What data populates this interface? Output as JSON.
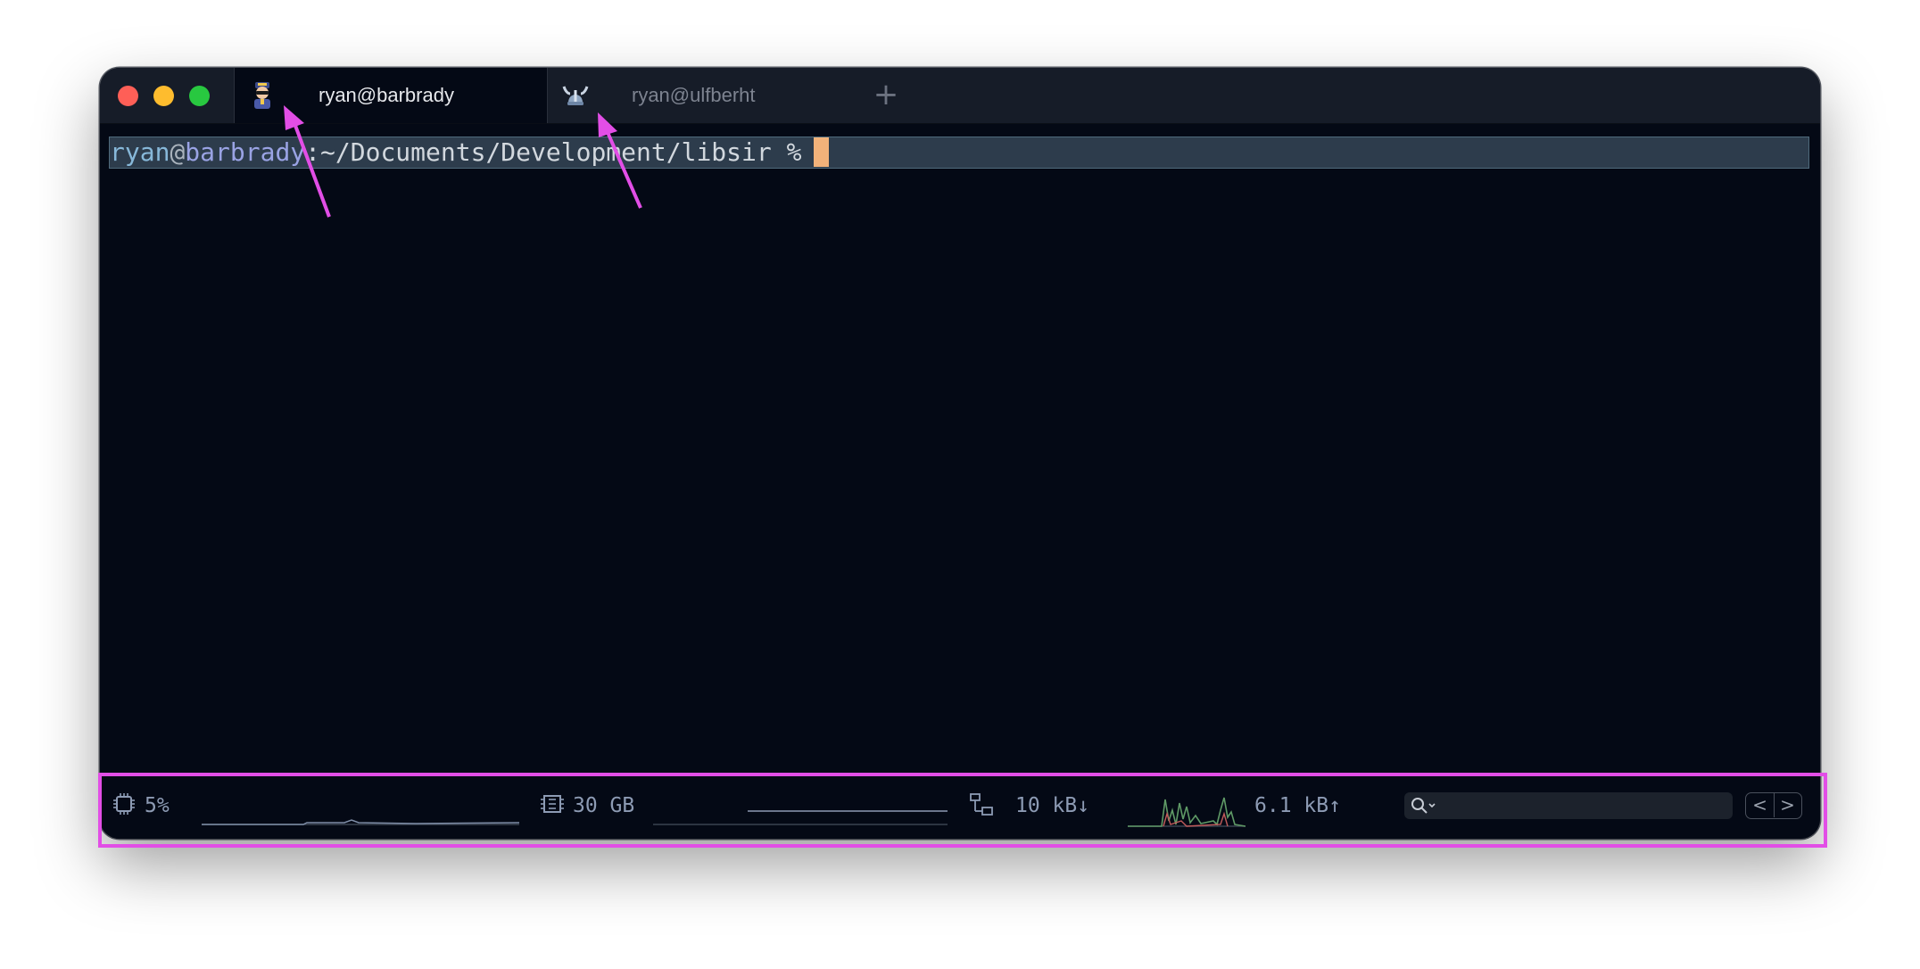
{
  "window": {
    "tabs": [
      {
        "label": "ryan@barbrady",
        "icon": "police-officer-icon",
        "active": true
      },
      {
        "label": "ryan@ulfberht",
        "icon": "viking-helmet-icon",
        "active": false
      }
    ],
    "new_tab_label": "+"
  },
  "terminal": {
    "prompt": {
      "user": "ryan",
      "at": "@",
      "host": "barbrady",
      "path": ":~/Documents/Development/libsir",
      "symbol": " %"
    }
  },
  "statusbar": {
    "cpu": {
      "value": "5%",
      "icon": "cpu-chip-icon"
    },
    "memory": {
      "value": "30 GB",
      "icon": "memory-icon"
    },
    "net_down": {
      "value": "10 kB↓",
      "icon": "network-icon"
    },
    "net_up": {
      "value": "6.1 kB↑"
    },
    "search": {
      "placeholder": "",
      "icon": "search-icon"
    },
    "nav": {
      "prev": "<",
      "next": ">"
    }
  },
  "colors": {
    "background": "#040915",
    "titlebar": "#161c28",
    "prompt_bg": "#2d3c4c",
    "cursor": "#f2b27a",
    "annotation": "#e24ee6"
  }
}
